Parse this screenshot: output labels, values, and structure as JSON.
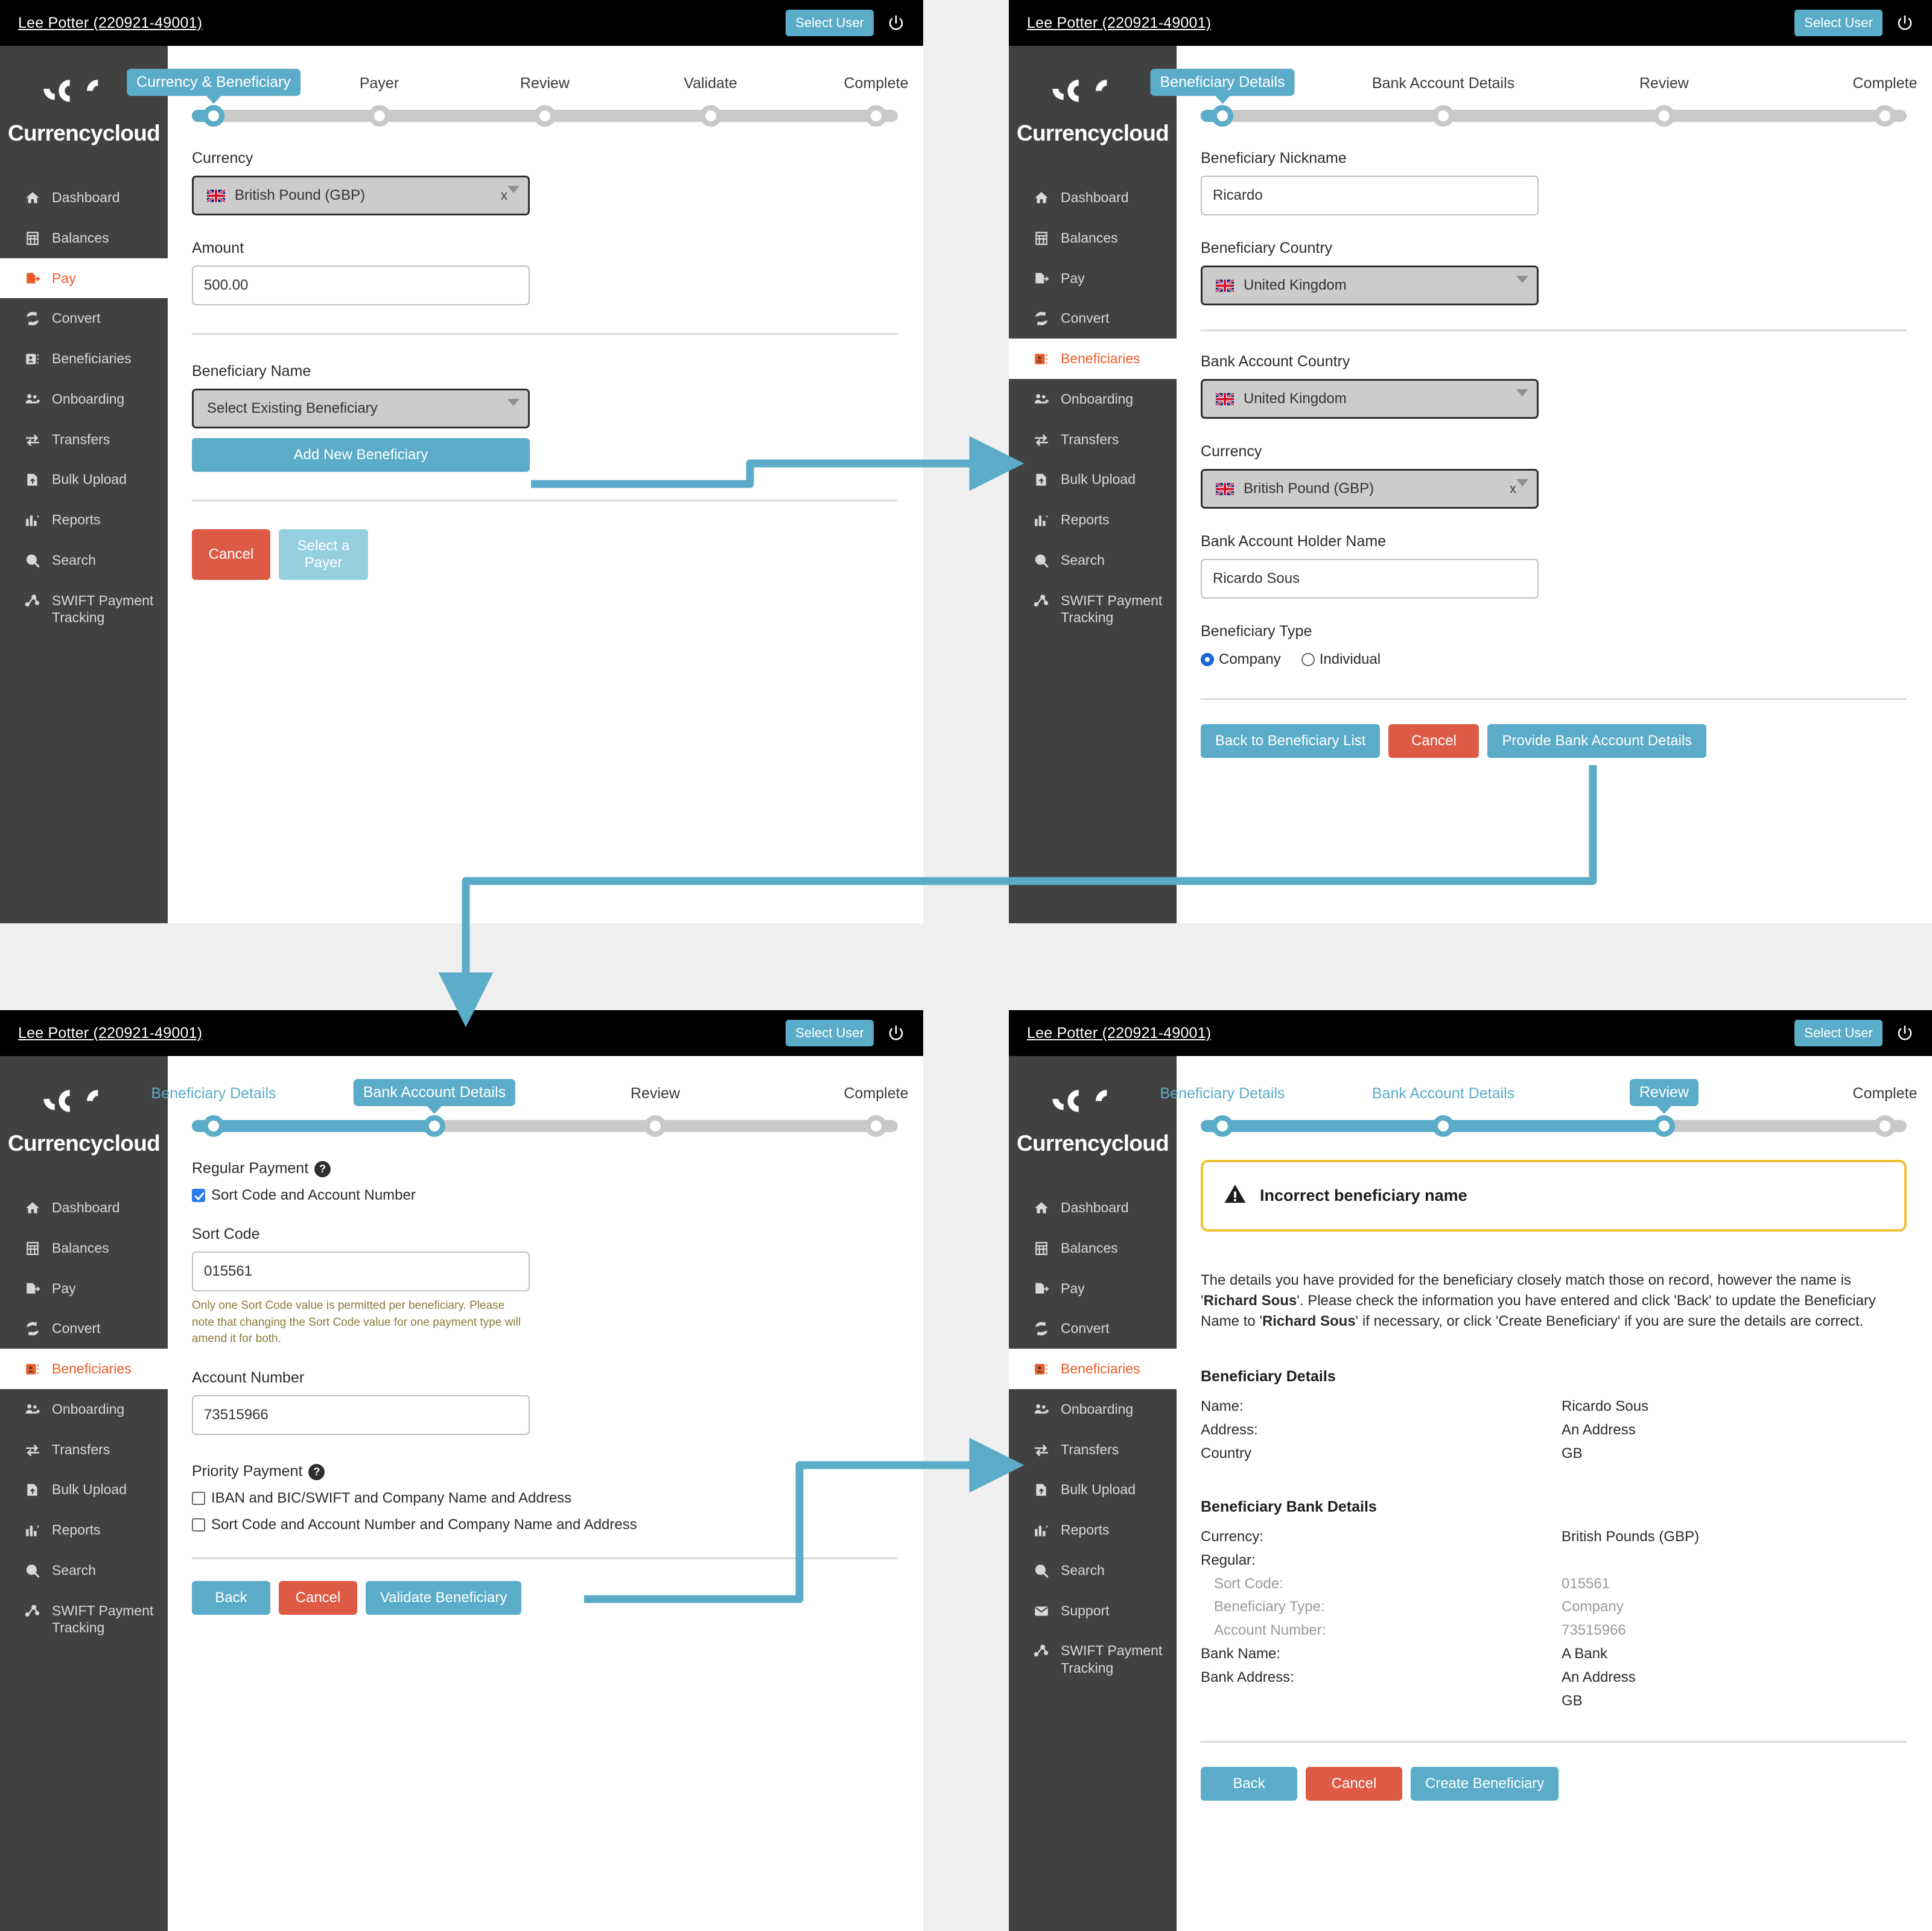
{
  "topbar": {
    "user": "Lee Potter (220921-49001)",
    "select_user_label": "Select User",
    "power_icon": "power-icon"
  },
  "brand": {
    "name": "Currencycloud"
  },
  "sidebar_pay": {
    "items": [
      {
        "label": "Dashboard",
        "icon": "home-icon",
        "active": false
      },
      {
        "label": "Balances",
        "icon": "grid-icon",
        "active": false
      },
      {
        "label": "Pay",
        "icon": "pay-icon",
        "active": true
      },
      {
        "label": "Convert",
        "icon": "convert-icon",
        "active": false
      },
      {
        "label": "Beneficiaries",
        "icon": "contact-card-icon",
        "active": false
      },
      {
        "label": "Onboarding",
        "icon": "users-icon",
        "active": false
      },
      {
        "label": "Transfers",
        "icon": "transfers-icon",
        "active": false
      },
      {
        "label": "Bulk Upload",
        "icon": "upload-icon",
        "active": false
      },
      {
        "label": "Reports",
        "icon": "reports-icon",
        "active": false
      },
      {
        "label": "Search",
        "icon": "search-icon",
        "active": false
      },
      {
        "label": "SWIFT Payment Tracking",
        "icon": "swift-icon",
        "active": false
      }
    ]
  },
  "sidebar_ben": {
    "items": [
      {
        "label": "Dashboard",
        "icon": "home-icon",
        "active": false
      },
      {
        "label": "Balances",
        "icon": "grid-icon",
        "active": false
      },
      {
        "label": "Pay",
        "icon": "pay-icon",
        "active": false
      },
      {
        "label": "Convert",
        "icon": "convert-icon",
        "active": false
      },
      {
        "label": "Beneficiaries",
        "icon": "contact-card-icon",
        "active": true
      },
      {
        "label": "Onboarding",
        "icon": "users-icon",
        "active": false
      },
      {
        "label": "Transfers",
        "icon": "transfers-icon",
        "active": false
      },
      {
        "label": "Bulk Upload",
        "icon": "upload-icon",
        "active": false
      },
      {
        "label": "Reports",
        "icon": "reports-icon",
        "active": false
      },
      {
        "label": "Search",
        "icon": "search-icon",
        "active": false
      },
      {
        "label": "SWIFT Payment Tracking",
        "icon": "swift-icon",
        "active": false
      }
    ]
  },
  "sidebar_ben_support": {
    "items": [
      {
        "label": "Dashboard",
        "icon": "home-icon",
        "active": false
      },
      {
        "label": "Balances",
        "icon": "grid-icon",
        "active": false
      },
      {
        "label": "Pay",
        "icon": "pay-icon",
        "active": false
      },
      {
        "label": "Convert",
        "icon": "convert-icon",
        "active": false
      },
      {
        "label": "Beneficiaries",
        "icon": "contact-card-icon",
        "active": true
      },
      {
        "label": "Onboarding",
        "icon": "users-icon",
        "active": false
      },
      {
        "label": "Transfers",
        "icon": "transfers-icon",
        "active": false
      },
      {
        "label": "Bulk Upload",
        "icon": "upload-icon",
        "active": false
      },
      {
        "label": "Reports",
        "icon": "reports-icon",
        "active": false
      },
      {
        "label": "Search",
        "icon": "search-icon",
        "active": false
      },
      {
        "label": "Support",
        "icon": "mail-icon",
        "active": false
      },
      {
        "label": "SWIFT Payment Tracking",
        "icon": "swift-icon",
        "active": false
      }
    ]
  },
  "panel_pay": {
    "steps": [
      {
        "label": "Currency & Beneficiary",
        "state": "current"
      },
      {
        "label": "Payer",
        "state": "todo"
      },
      {
        "label": "Review",
        "state": "todo"
      },
      {
        "label": "Validate",
        "state": "todo"
      },
      {
        "label": "Complete",
        "state": "todo"
      }
    ],
    "currency_label": "Currency",
    "currency_value": "British Pound (GBP)",
    "currency_clear": "x",
    "amount_label": "Amount",
    "amount_value": "500.00",
    "beneficiary_name_label": "Beneficiary Name",
    "beneficiary_select_value": "Select Existing Beneficiary",
    "add_new_beneficiary_label": "Add New Beneficiary",
    "cancel_label": "Cancel",
    "select_payer_label": "Select a Payer"
  },
  "panel_ben_details": {
    "steps": [
      {
        "label": "Beneficiary Details",
        "state": "current"
      },
      {
        "label": "Bank Account Details",
        "state": "todo"
      },
      {
        "label": "Review",
        "state": "todo"
      },
      {
        "label": "Complete",
        "state": "todo"
      }
    ],
    "nickname_label": "Beneficiary Nickname",
    "nickname_value": "Ricardo",
    "ben_country_label": "Beneficiary Country",
    "ben_country_value": "United Kingdom",
    "bank_country_label": "Bank Account Country",
    "bank_country_value": "United Kingdom",
    "currency_label": "Currency",
    "currency_value": "British Pound (GBP)",
    "currency_clear": "x",
    "holder_label": "Bank Account Holder Name",
    "holder_value": "Ricardo Sous",
    "ben_type_label": "Beneficiary Type",
    "type_company": "Company",
    "type_individual": "Individual",
    "back_to_list_label": "Back to Beneficiary List",
    "cancel_label": "Cancel",
    "provide_bank_label": "Provide Bank Account Details"
  },
  "panel_bank_details": {
    "steps": [
      {
        "label": "Beneficiary Details",
        "state": "done"
      },
      {
        "label": "Bank Account Details",
        "state": "current"
      },
      {
        "label": "Review",
        "state": "todo"
      },
      {
        "label": "Complete",
        "state": "todo"
      }
    ],
    "regular_payment_label": "Regular Payment",
    "regular_checkbox_label": "Sort Code and Account Number",
    "sort_code_label": "Sort Code",
    "sort_code_value": "015561",
    "sort_code_hint": "Only one Sort Code value is permitted per beneficiary. Please note that changing the Sort Code value for one payment type will amend it for both.",
    "account_number_label": "Account Number",
    "account_number_value": "73515966",
    "priority_payment_label": "Priority Payment",
    "priority_option_1": "IBAN and BIC/SWIFT and Company Name and Address",
    "priority_option_2": "Sort Code and Account Number and Company Name and Address",
    "back_label": "Back",
    "cancel_label": "Cancel",
    "validate_label": "Validate Beneficiary"
  },
  "panel_review": {
    "steps": [
      {
        "label": "Beneficiary Details",
        "state": "done"
      },
      {
        "label": "Bank Account Details",
        "state": "done"
      },
      {
        "label": "Review",
        "state": "current"
      },
      {
        "label": "Complete",
        "state": "todo"
      }
    ],
    "warning_icon": "warning-triangle-icon",
    "warning_title": "Incorrect beneficiary name",
    "paragraph_1": "The details you have provided for the beneficiary closely match those on record, however the name is '",
    "paragraph_name_1": "Richard Sous",
    "paragraph_2": "'. Please check the information you have entered and click 'Back' to update the Beneficiary Name to '",
    "paragraph_name_2": "Richard Sous",
    "paragraph_3": "' if necessary, or click 'Create Beneficiary' if you are sure the details are correct.",
    "beneficiary_details_title": "Beneficiary Details",
    "beneficiary_rows": [
      {
        "key": "Name:",
        "value": "Ricardo Sous",
        "muted": false,
        "indent": false
      },
      {
        "key": "Address:",
        "value": "An Address",
        "muted": false,
        "indent": false
      },
      {
        "key": "Country",
        "value": "GB",
        "muted": false,
        "indent": false
      }
    ],
    "bank_details_title": "Beneficiary Bank Details",
    "bank_rows": [
      {
        "key": "Currency:",
        "value": "British Pounds (GBP)",
        "muted": false,
        "indent": false
      },
      {
        "key": "Regular:",
        "value": "",
        "muted": false,
        "indent": false
      },
      {
        "key": "Sort Code:",
        "value": "015561",
        "muted": true,
        "indent": true
      },
      {
        "key": "Beneficiary Type:",
        "value": "Company",
        "muted": true,
        "indent": true
      },
      {
        "key": "Account Number:",
        "value": "73515966",
        "muted": true,
        "indent": true
      },
      {
        "key": "Bank Name:",
        "value": "A Bank",
        "muted": false,
        "indent": false
      },
      {
        "key": "Bank Address:",
        "value": "An Address",
        "muted": false,
        "indent": false
      },
      {
        "key": "",
        "value": "GB",
        "muted": false,
        "indent": false
      }
    ],
    "back_label": "Back",
    "cancel_label": "Cancel",
    "create_label": "Create Beneficiary"
  },
  "flow": {
    "arrow_1": "add-new-beneficiary-to-beneficiary-details",
    "arrow_2": "provide-bank-account-details-to-bank-account-details",
    "arrow_3": "validate-beneficiary-to-review"
  },
  "colors": {
    "accent_blue": "#5bacc8",
    "danger_red": "#dd5a45",
    "brand_orange": "#ec5b26",
    "sidebar_dark": "#414141",
    "warning_yellow": "#efc033",
    "page_bg": "#f0f0f0"
  }
}
